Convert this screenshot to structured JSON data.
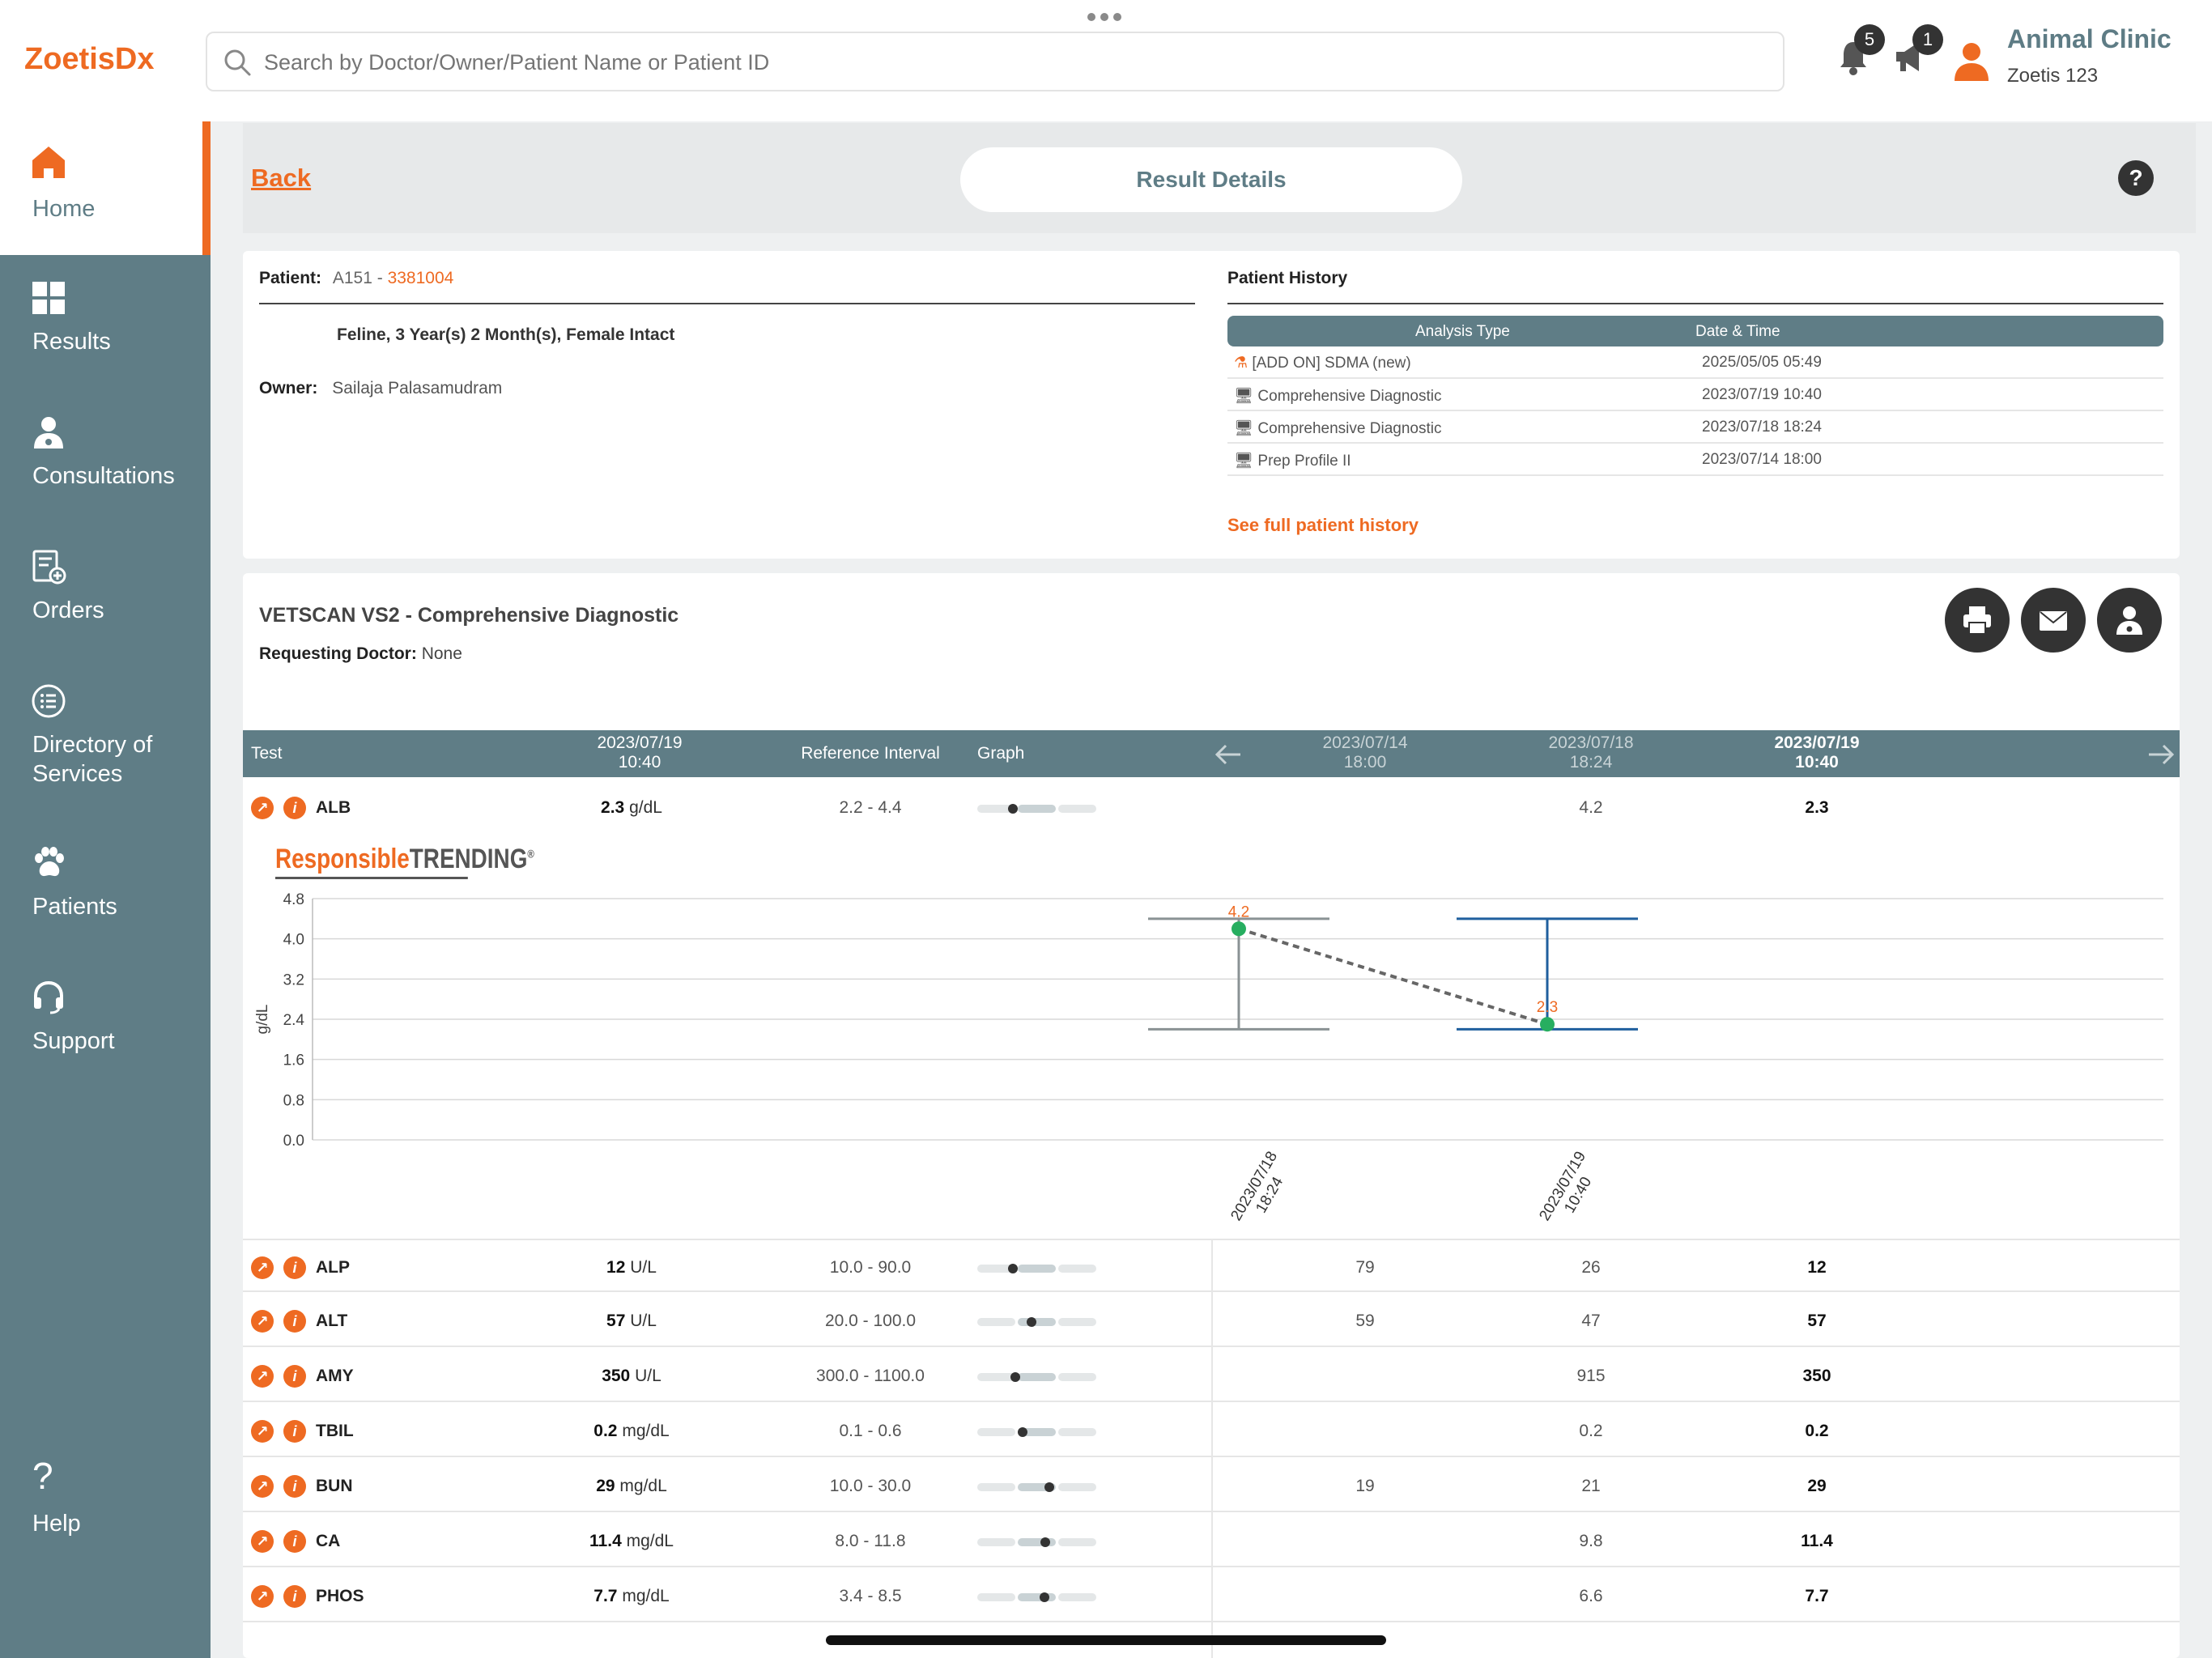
{
  "app": {
    "logo": "ZoetisDx",
    "search_placeholder": "Search by Doctor/Owner/Patient Name or Patient ID",
    "notifications_count": "5",
    "announcements_count": "1",
    "clinic_name": "Animal Clinic",
    "clinic_sub": "Zoetis 123",
    "accent_color": "#ee6a22",
    "sidebar_color": "#5f7d86"
  },
  "sidebar": {
    "items": [
      {
        "label": "Home",
        "icon": "home-icon"
      },
      {
        "label": "Results",
        "icon": "grid-icon"
      },
      {
        "label": "Consultations",
        "icon": "doctor-icon"
      },
      {
        "label": "Orders",
        "icon": "orders-icon"
      },
      {
        "label": "Directory of Services",
        "icon": "list-icon"
      },
      {
        "label": "Patients",
        "icon": "paw-icon"
      },
      {
        "label": "Support",
        "icon": "headset-icon"
      },
      {
        "label": "Help",
        "icon": "question-icon"
      }
    ]
  },
  "header": {
    "back_label": "Back",
    "title": "Result Details",
    "help": "?"
  },
  "patient": {
    "label": "Patient:",
    "name": "A151 - ",
    "id": "3381004",
    "description": "Feline, 3 Year(s) 2 Month(s), Female Intact",
    "owner_label": "Owner:",
    "owner": "Sailaja Palasamudram"
  },
  "history": {
    "title": "Patient History",
    "col_type": "Analysis Type",
    "col_date": "Date & Time",
    "rows": [
      {
        "type": "[ADD ON] SDMA (new)",
        "date": "2025/05/05 05:49"
      },
      {
        "type": "Comprehensive Diagnostic",
        "date": "2023/07/19 10:40"
      },
      {
        "type": "Comprehensive Diagnostic",
        "date": "2023/07/18 18:24"
      },
      {
        "type": "Prep Profile II",
        "date": "2023/07/14 18:00"
      }
    ],
    "see_full": "See full patient history"
  },
  "results": {
    "title": "VETSCAN VS2 - Comprehensive Diagnostic",
    "req_label": "Requesting Doctor:",
    "req_value": "None",
    "head": {
      "test": "Test",
      "current_date": "2023/07/19",
      "current_time": "10:40",
      "ref": "Reference Interval",
      "graph": "Graph",
      "h1_date": "2023/07/14",
      "h1_time": "18:00",
      "h2_date": "2023/07/18",
      "h2_time": "18:24",
      "h3_date": "2023/07/19",
      "h3_time": "10:40"
    },
    "rows": [
      {
        "test": "ALB",
        "value": "2.3",
        "unit": "g/dL",
        "ref": "2.2 - 4.4",
        "h1": "",
        "h2": "4.2",
        "h3": "2.3",
        "level": 0.3
      },
      {
        "test": "ALP",
        "value": "12",
        "unit": "U/L",
        "ref": "10.0 - 90.0",
        "h1": "79",
        "h2": "26",
        "h3": "12",
        "level": 0.3
      },
      {
        "test": "ALT",
        "value": "57",
        "unit": "U/L",
        "ref": "20.0 - 100.0",
        "h1": "59",
        "h2": "47",
        "h3": "57",
        "level": 0.45
      },
      {
        "test": "AMY",
        "value": "350",
        "unit": "U/L",
        "ref": "300.0 - 1100.0",
        "h1": "",
        "h2": "915",
        "h3": "350",
        "level": 0.32
      },
      {
        "test": "TBIL",
        "value": "0.2",
        "unit": "mg/dL",
        "ref": "0.1 - 0.6",
        "h1": "",
        "h2": "0.2",
        "h3": "0.2",
        "level": 0.38
      },
      {
        "test": "BUN",
        "value": "29",
        "unit": "mg/dL",
        "ref": "10.0 - 30.0",
        "h1": "19",
        "h2": "21",
        "h3": "29",
        "level": 0.6
      },
      {
        "test": "CA",
        "value": "11.4",
        "unit": "mg/dL",
        "ref": "8.0 - 11.8",
        "h1": "",
        "h2": "9.8",
        "h3": "11.4",
        "level": 0.57
      },
      {
        "test": "PHOS",
        "value": "7.7",
        "unit": "mg/dL",
        "ref": "3.4 - 8.5",
        "h1": "",
        "h2": "6.6",
        "h3": "7.7",
        "level": 0.56
      }
    ]
  },
  "trend": {
    "logo_responsible": "Responsible",
    "logo_trending": "TRENDING",
    "logo_mark": "®",
    "ylabel": "g/dL",
    "yticks": [
      "4.8",
      "4.0",
      "3.2",
      "2.4",
      "1.6",
      "0.8",
      "0.0"
    ],
    "ylim": [
      0,
      4.8
    ],
    "points": [
      {
        "date": "2023/07/18",
        "time": "18:24",
        "value": 4.2,
        "label": "4.2",
        "ref_low": 2.2,
        "ref_high": 4.4,
        "color": "#8a9294"
      },
      {
        "date": "2023/07/19",
        "time": "10:40",
        "value": 2.3,
        "label": "2.3",
        "ref_low": 2.2,
        "ref_high": 4.4,
        "color": "#1f5f9e"
      }
    ]
  }
}
